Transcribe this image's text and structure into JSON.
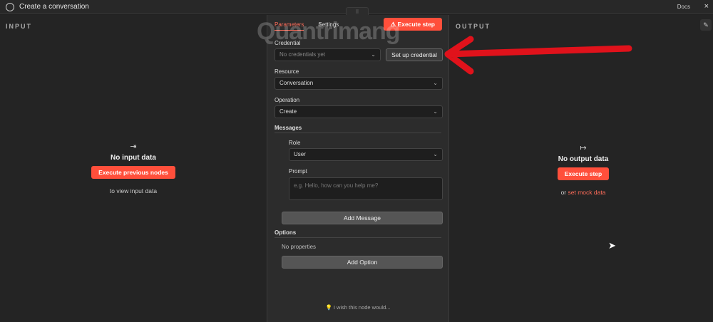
{
  "window": {
    "title": "Create a conversation",
    "docs": "Docs",
    "close": "×"
  },
  "input": {
    "header": "INPUT",
    "empty_title": "No input data",
    "button": "Execute previous nodes",
    "hint": "to view input data"
  },
  "output": {
    "header": "OUTPUT",
    "empty_title": "No output data",
    "button": "Execute step",
    "hint_prefix": "or",
    "hint_link": "set mock data"
  },
  "params": {
    "tabs": [
      "Parameters",
      "Settings"
    ],
    "execute": "Execute step",
    "credential_label": "Credential",
    "credential_value": "No credentials yet",
    "setup": "Set up credential",
    "resource_label": "Resource",
    "resource_value": "Conversation",
    "operation_label": "Operation",
    "operation_value": "Create",
    "messages_label": "Messages",
    "role_label": "Role",
    "role_value": "User",
    "prompt_label": "Prompt",
    "prompt_placeholder": "e.g. Hello, how can you help me?",
    "add_message": "Add Message",
    "options_label": "Options",
    "no_props": "No properties",
    "add_option": "Add Option",
    "feedback": "I wish this node would..."
  },
  "watermark": "Quantrimang",
  "colors": {
    "accent": "#ff4f3b",
    "arrow": "#e0121b"
  }
}
